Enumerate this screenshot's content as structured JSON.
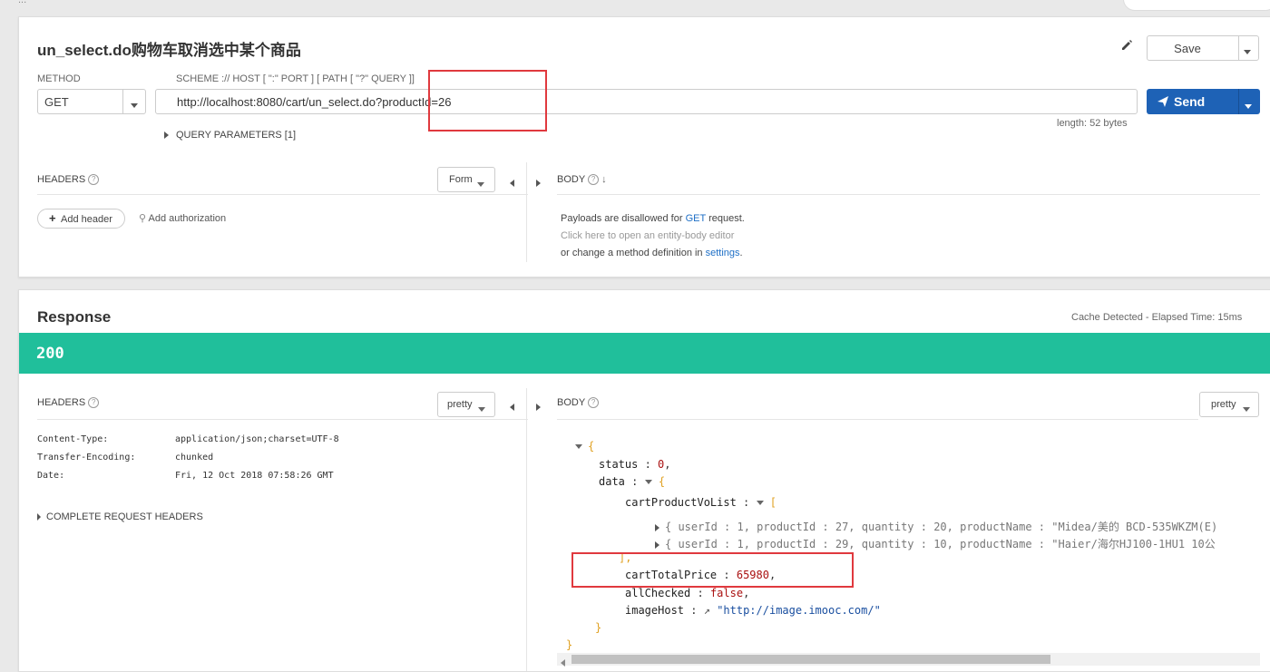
{
  "breadcrumb": {
    "text": "..."
  },
  "env_button": {
    "label": "..."
  },
  "request": {
    "title": "un_select.do购物车取消选中某个商品",
    "save_label": "Save",
    "method_label": "METHOD",
    "method_value": "GET",
    "scheme_label": "SCHEME :// HOST [ \":\" PORT ] [ PATH [ \"?\" QUERY ]]",
    "url": "http://localhost:8080/cart/un_select.do?productId=26",
    "length_text": "length: 52 bytes",
    "send_label": "Send",
    "query_params_label": "QUERY PARAMETERS [1]",
    "headers_label": "HEADERS",
    "form_label": "Form",
    "body_label": "BODY",
    "add_header_label": "Add header",
    "add_auth_label": "Add authorization",
    "body_msg": {
      "line1_a": "Payloads are disallowed for",
      "line1_link": "GET",
      "line1_b": "request.",
      "line2": "Click here to open an entity-body editor",
      "line3_a": "or change a method definition in",
      "line3_link": "settings",
      "line3_b": "."
    }
  },
  "response": {
    "title": "Response",
    "cache_text": "Cache Detected - Elapsed Time: 15ms",
    "status_code": "200",
    "status_color": "#20bf9b",
    "headers_label": "HEADERS",
    "pretty_label": "pretty",
    "body_label": "BODY",
    "headers": [
      {
        "name": "Content-Type:",
        "value": "application/json;charset=UTF-8"
      },
      {
        "name": "Transfer-Encoding:",
        "value": "chunked"
      },
      {
        "name": "Date:",
        "value": "Fri, 12 Oct 2018 07:58:26 GMT"
      }
    ],
    "complete_headers_label": "COMPLETE REQUEST HEADERS",
    "json": {
      "open_brace": "{",
      "status_key": "status",
      "status_val": "0",
      "data_key": "data",
      "cartlist_key": "cartProductVoList",
      "item1": "{ userId :  1,  productId :  27,  quantity :  20,  productName :  \"Midea/美的 BCD-535WKZM(E)",
      "item2": "{ userId :  1,  productId :  29,  quantity :  10,  productName :  \"Haier/海尔HJ100-1HU1 10公",
      "close_bracket": "],",
      "total_key": "cartTotalPrice",
      "total_val": "65980",
      "allchecked_key": "allChecked",
      "allchecked_val": "false",
      "imagehost_key": "imageHost",
      "imagehost_val": "\"http://image.imooc.com/\"",
      "close_inner": "}",
      "close_outer": "}"
    }
  },
  "colors": {
    "accent": "#1e62b6",
    "red_box": "#e0393e",
    "status_bar": "#20bf9b"
  }
}
